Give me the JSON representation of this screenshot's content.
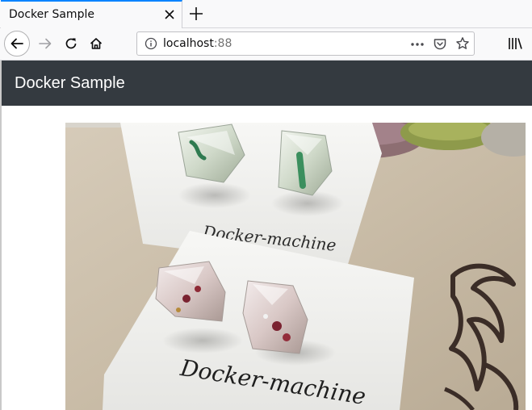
{
  "browser": {
    "tab": {
      "title": "Docker Sample"
    },
    "url": {
      "host": "localhost",
      "port": ":88"
    }
  },
  "page": {
    "brand": "Docker Sample",
    "photo": {
      "card_top_text": "Docker-machine",
      "card_bottom_text": "Docker-machine"
    }
  },
  "colors": {
    "header_bg": "#343a40",
    "tab_accent": "#0a84ff",
    "card_white": "#f4f4f2",
    "table_beige": "#c9bba6"
  },
  "icons": [
    "close-icon",
    "plus-icon",
    "back-arrow-icon",
    "forward-arrow-icon",
    "reload-icon",
    "home-icon",
    "info-icon",
    "more-icon",
    "pocket-icon",
    "star-icon",
    "library-icon"
  ]
}
